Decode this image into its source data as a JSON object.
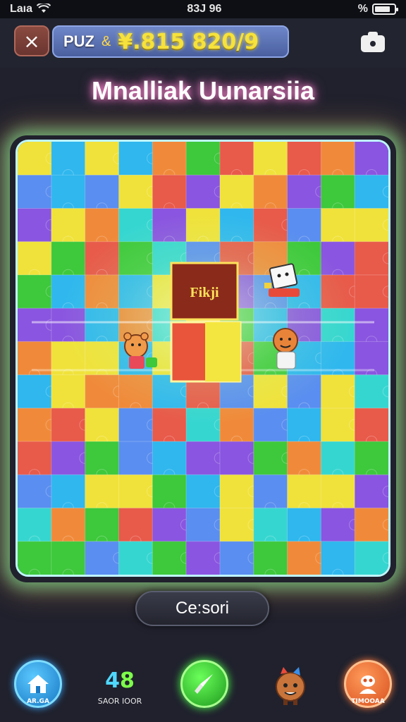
{
  "status_bar": {
    "carrier": "Laıa",
    "time": "83J 96",
    "battery_text": "%"
  },
  "header": {
    "close_label": "×",
    "brand": "PUZ",
    "amp": "&",
    "score": "¥.815 820/9"
  },
  "level": {
    "title": "Mnalliak Uunarsiia"
  },
  "board": {
    "center_tile_label": "Fikji",
    "colors": [
      "#2fb7ee",
      "#8a55e0",
      "#3ec83c",
      "#f0e23a",
      "#f08a3a",
      "#e85a4a",
      "#36d6d0",
      "#5a8ef0"
    ]
  },
  "cursor_button": {
    "label": "Ce:sori"
  },
  "bottom": {
    "home_label": "AR.GA",
    "moves_value_a": "4",
    "moves_value_b": "8",
    "moves_label": "SAOR IOOR",
    "profile_label": "TIMOOAA"
  }
}
